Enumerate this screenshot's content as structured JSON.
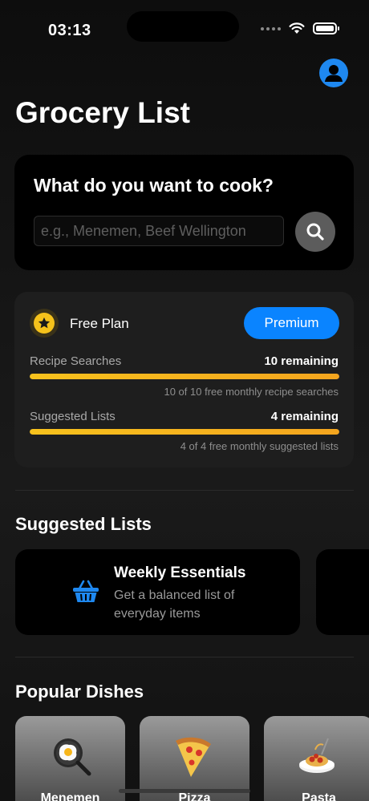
{
  "status_bar": {
    "time": "03:13"
  },
  "header": {
    "title": "Grocery List",
    "profile_icon": "person-icon"
  },
  "search": {
    "heading": "What do you want to cook?",
    "placeholder": "e.g., Menemen, Beef Wellington",
    "value": "",
    "button_icon": "search-icon"
  },
  "plan": {
    "name": "Free Plan",
    "badge_icon": "star-icon",
    "premium_label": "Premium",
    "usages": [
      {
        "label": "Recipe Searches",
        "remaining": "10 remaining",
        "note": "10 of 10 free monthly recipe searches",
        "fraction": 1.0
      },
      {
        "label": "Suggested Lists",
        "remaining": "4 remaining",
        "note": "4 of 4 free monthly suggested lists",
        "fraction": 1.0
      }
    ]
  },
  "suggested": {
    "title": "Suggested Lists",
    "items": [
      {
        "title": "Weekly Essentials",
        "description": "Get a balanced list of everyday items",
        "icon": "basket-icon"
      }
    ]
  },
  "popular": {
    "title": "Popular Dishes",
    "dishes": [
      {
        "name": "Menemen",
        "icon": "pan-egg-icon"
      },
      {
        "name": "Pizza",
        "icon": "pizza-icon"
      },
      {
        "name": "Pasta",
        "icon": "spaghetti-icon"
      }
    ]
  },
  "colors": {
    "accent": "#0a84ff",
    "progress": "#f7c21d",
    "star": "#f5c21b"
  }
}
